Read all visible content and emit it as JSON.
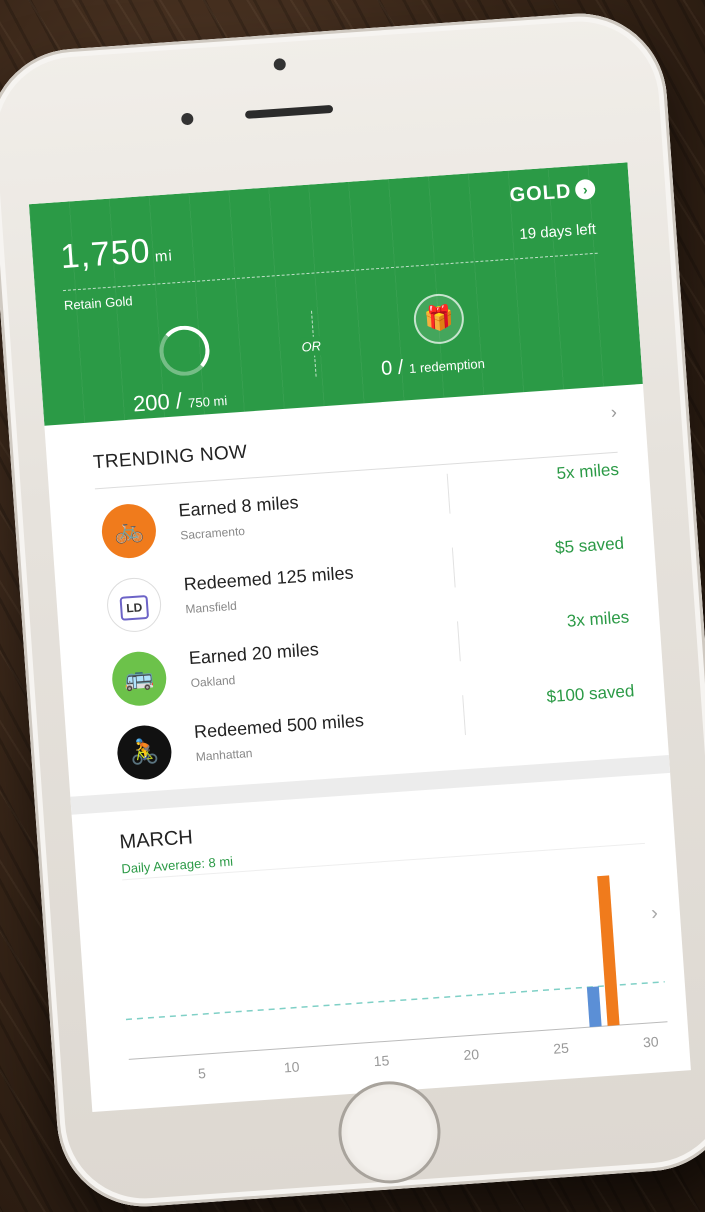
{
  "header": {
    "miles": "1,750",
    "miles_unit": "mi",
    "tier": "GOLD",
    "days_left": "19 days left",
    "goal_label": "Retain Gold",
    "progress_value": "200",
    "progress_sep": " / ",
    "progress_goal": "750 mi",
    "progress_fraction": 0.267,
    "or_label": "OR",
    "redeem_value": "0",
    "redeem_sep": " / ",
    "redeem_goal": "1 redemption"
  },
  "trending": {
    "title": "TRENDING NOW",
    "items": [
      {
        "title": "Earned 8 miles",
        "location": "Sacramento",
        "reward": "5x miles",
        "icon": "bicycle-icon",
        "color": "#f07b1c"
      },
      {
        "title": "Redeemed 125 miles",
        "location": "Mansfield",
        "reward": "$5 saved",
        "icon": "ld-logo-icon",
        "badge": "LD",
        "color": "#ffffff"
      },
      {
        "title": "Earned 20 miles",
        "location": "Oakland",
        "reward": "3x miles",
        "icon": "bus-icon",
        "color": "#6cc24a"
      },
      {
        "title": "Redeemed 500 miles",
        "location": "Manhattan",
        "reward": "$100 saved",
        "icon": "courier-bike-icon",
        "color": "#111111"
      }
    ]
  },
  "chart": {
    "title": "MARCH",
    "daily_average": "Daily Average: 8 mi"
  },
  "chart_data": {
    "type": "bar",
    "title": "MARCH",
    "x_ticks": [
      5,
      10,
      15,
      20,
      25,
      30
    ],
    "xlim": [
      1,
      31
    ],
    "average": 8,
    "series": [
      {
        "color": "#5b8fd6",
        "x": [
          27
        ],
        "values": [
          8
        ]
      },
      {
        "color": "#f07b1c",
        "x": [
          28
        ],
        "values": [
          30
        ]
      }
    ],
    "ylim": [
      0,
      32
    ]
  },
  "colors": {
    "brand_green": "#2b9a46",
    "orange": "#f07b1c",
    "blue": "#5b8fd6"
  }
}
